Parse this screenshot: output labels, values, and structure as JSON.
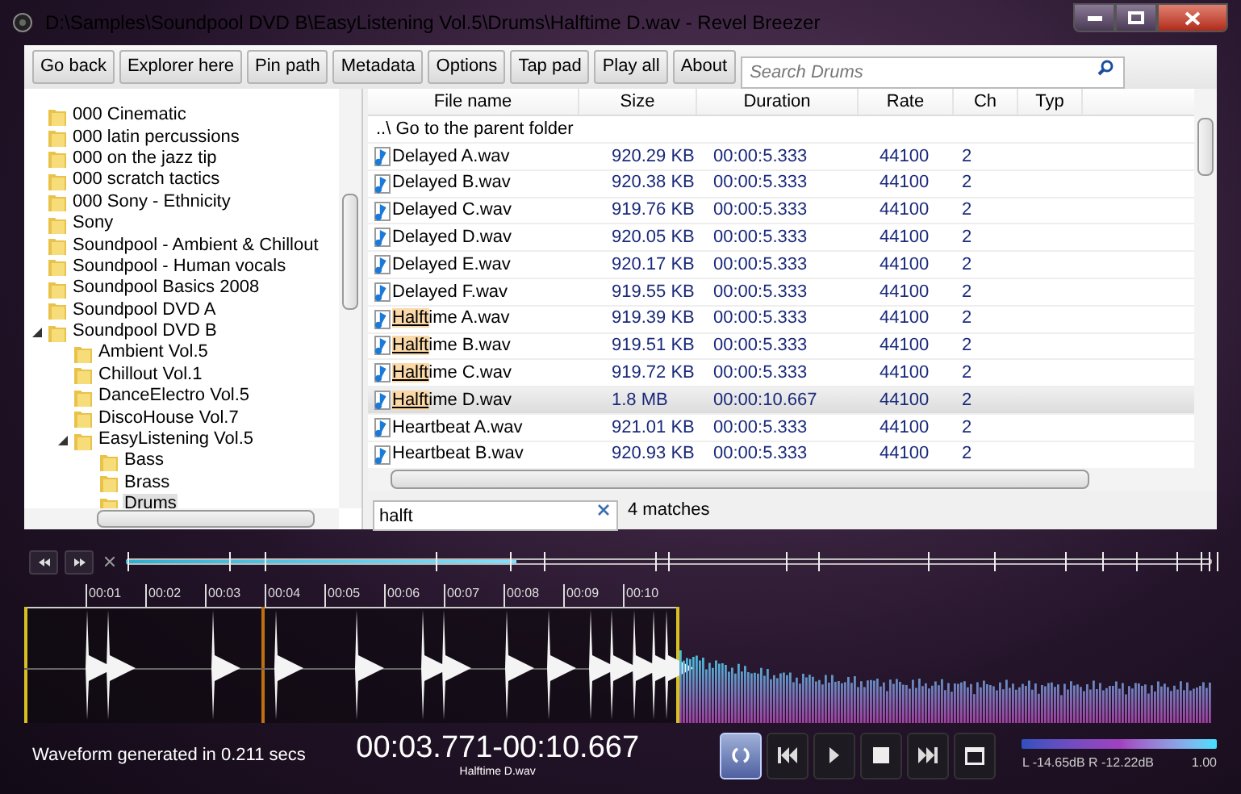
{
  "window": {
    "title": "D:\\Samples\\Soundpool DVD B\\EasyListening Vol.5\\Drums\\Halftime D.wav - Revel Breezer"
  },
  "toolbar": {
    "buttons": [
      "Go back",
      "Explorer here",
      "Pin path",
      "Metadata",
      "Options",
      "Tap pad",
      "Play all",
      "About"
    ]
  },
  "search": {
    "placeholder": "Search Drums"
  },
  "tree": {
    "items": [
      {
        "label": "000 Cinematic",
        "selected": false
      },
      {
        "label": "000 latin percussions",
        "selected": false
      },
      {
        "label": "000 on the jazz tip",
        "selected": false
      },
      {
        "label": "000 scratch tactics",
        "selected": false
      },
      {
        "label": "000 Sony - Ethnicity",
        "selected": false
      },
      {
        "label": "Sony",
        "selected": false
      },
      {
        "label": "Soundpool - Ambient & Chillout",
        "selected": false
      },
      {
        "label": "Soundpool - Human vocals",
        "selected": false
      },
      {
        "label": "Soundpool Basics 2008",
        "selected": false
      },
      {
        "label": "Soundpool DVD A",
        "selected": false
      },
      {
        "label": "Soundpool DVD B",
        "selected": false,
        "expanded": true,
        "children": [
          {
            "label": "Ambient Vol.5",
            "selected": false
          },
          {
            "label": "Chillout Vol.1",
            "selected": false
          },
          {
            "label": "DanceElectro Vol.5",
            "selected": false
          },
          {
            "label": "DiscoHouse Vol.7",
            "selected": false
          },
          {
            "label": "EasyListening Vol.5",
            "selected": false,
            "expanded": true,
            "children": [
              {
                "label": "Bass",
                "selected": false
              },
              {
                "label": "Brass",
                "selected": false
              },
              {
                "label": "Drums",
                "selected": true
              }
            ]
          }
        ]
      }
    ]
  },
  "file_list": {
    "columns": [
      "File name",
      "Size",
      "Duration",
      "Rate",
      "Ch",
      "Typ"
    ],
    "parent_row": "..\\ Go to the parent folder",
    "rows": [
      {
        "name": [
          {
            "text": "Delayed A.wav",
            "match": false
          }
        ],
        "size": "920.29 KB",
        "duration": "00:00:5.333",
        "rate": "44100",
        "ch": "2",
        "selected": false
      },
      {
        "name": [
          {
            "text": "Delayed B.wav",
            "match": false
          }
        ],
        "size": "920.38 KB",
        "duration": "00:00:5.333",
        "rate": "44100",
        "ch": "2",
        "selected": false
      },
      {
        "name": [
          {
            "text": "Delayed C.wav",
            "match": false
          }
        ],
        "size": "919.76 KB",
        "duration": "00:00:5.333",
        "rate": "44100",
        "ch": "2",
        "selected": false
      },
      {
        "name": [
          {
            "text": "Delayed D.wav",
            "match": false
          }
        ],
        "size": "920.05 KB",
        "duration": "00:00:5.333",
        "rate": "44100",
        "ch": "2",
        "selected": false
      },
      {
        "name": [
          {
            "text": "Delayed E.wav",
            "match": false
          }
        ],
        "size": "920.17 KB",
        "duration": "00:00:5.333",
        "rate": "44100",
        "ch": "2",
        "selected": false
      },
      {
        "name": [
          {
            "text": "Delayed F.wav",
            "match": false
          }
        ],
        "size": "919.55 KB",
        "duration": "00:00:5.333",
        "rate": "44100",
        "ch": "2",
        "selected": false
      },
      {
        "name": [
          {
            "text": "Halft",
            "match": true
          },
          {
            "text": "ime A.wav",
            "match": false
          }
        ],
        "size": "919.39 KB",
        "duration": "00:00:5.333",
        "rate": "44100",
        "ch": "2",
        "selected": false
      },
      {
        "name": [
          {
            "text": "Halft",
            "match": true
          },
          {
            "text": "ime B.wav",
            "match": false
          }
        ],
        "size": "919.51 KB",
        "duration": "00:00:5.333",
        "rate": "44100",
        "ch": "2",
        "selected": false
      },
      {
        "name": [
          {
            "text": "Halft",
            "match": true
          },
          {
            "text": "ime C.wav",
            "match": false
          }
        ],
        "size": "919.72 KB",
        "duration": "00:00:5.333",
        "rate": "44100",
        "ch": "2",
        "selected": false
      },
      {
        "name": [
          {
            "text": "Halft",
            "match": true
          },
          {
            "text": "ime D.wav",
            "match": false
          }
        ],
        "size": "1.8 MB",
        "duration": "00:00:10.667",
        "rate": "44100",
        "ch": "2",
        "selected": true
      },
      {
        "name": [
          {
            "text": "Heartbeat A.wav",
            "match": false
          }
        ],
        "size": "921.01 KB",
        "duration": "00:00:5.333",
        "rate": "44100",
        "ch": "2",
        "selected": false
      },
      {
        "name": [
          {
            "text": "Heartbeat B.wav",
            "match": false
          }
        ],
        "size": "920.93 KB",
        "duration": "00:00:5.333",
        "rate": "44100",
        "ch": "2",
        "selected": false
      }
    ]
  },
  "filter": {
    "value": "halft",
    "count": "4 matches"
  },
  "playback": {
    "level": 0.36
  },
  "ruler": {
    "ticks": [
      "00:01",
      "00:02",
      "00:03",
      "00:04",
      "00:05",
      "00:06",
      "00:07",
      "00:08",
      "00:09",
      "00:10"
    ]
  },
  "status": "Waveform generated in 0.211 secs",
  "time_range": "00:03.771-00:10.667",
  "file_label": "Halftime D.wav",
  "loop": {
    "on": true
  },
  "meter": {
    "reading": "L -14.65dB R -12.22dB",
    "value": "1.00"
  }
}
